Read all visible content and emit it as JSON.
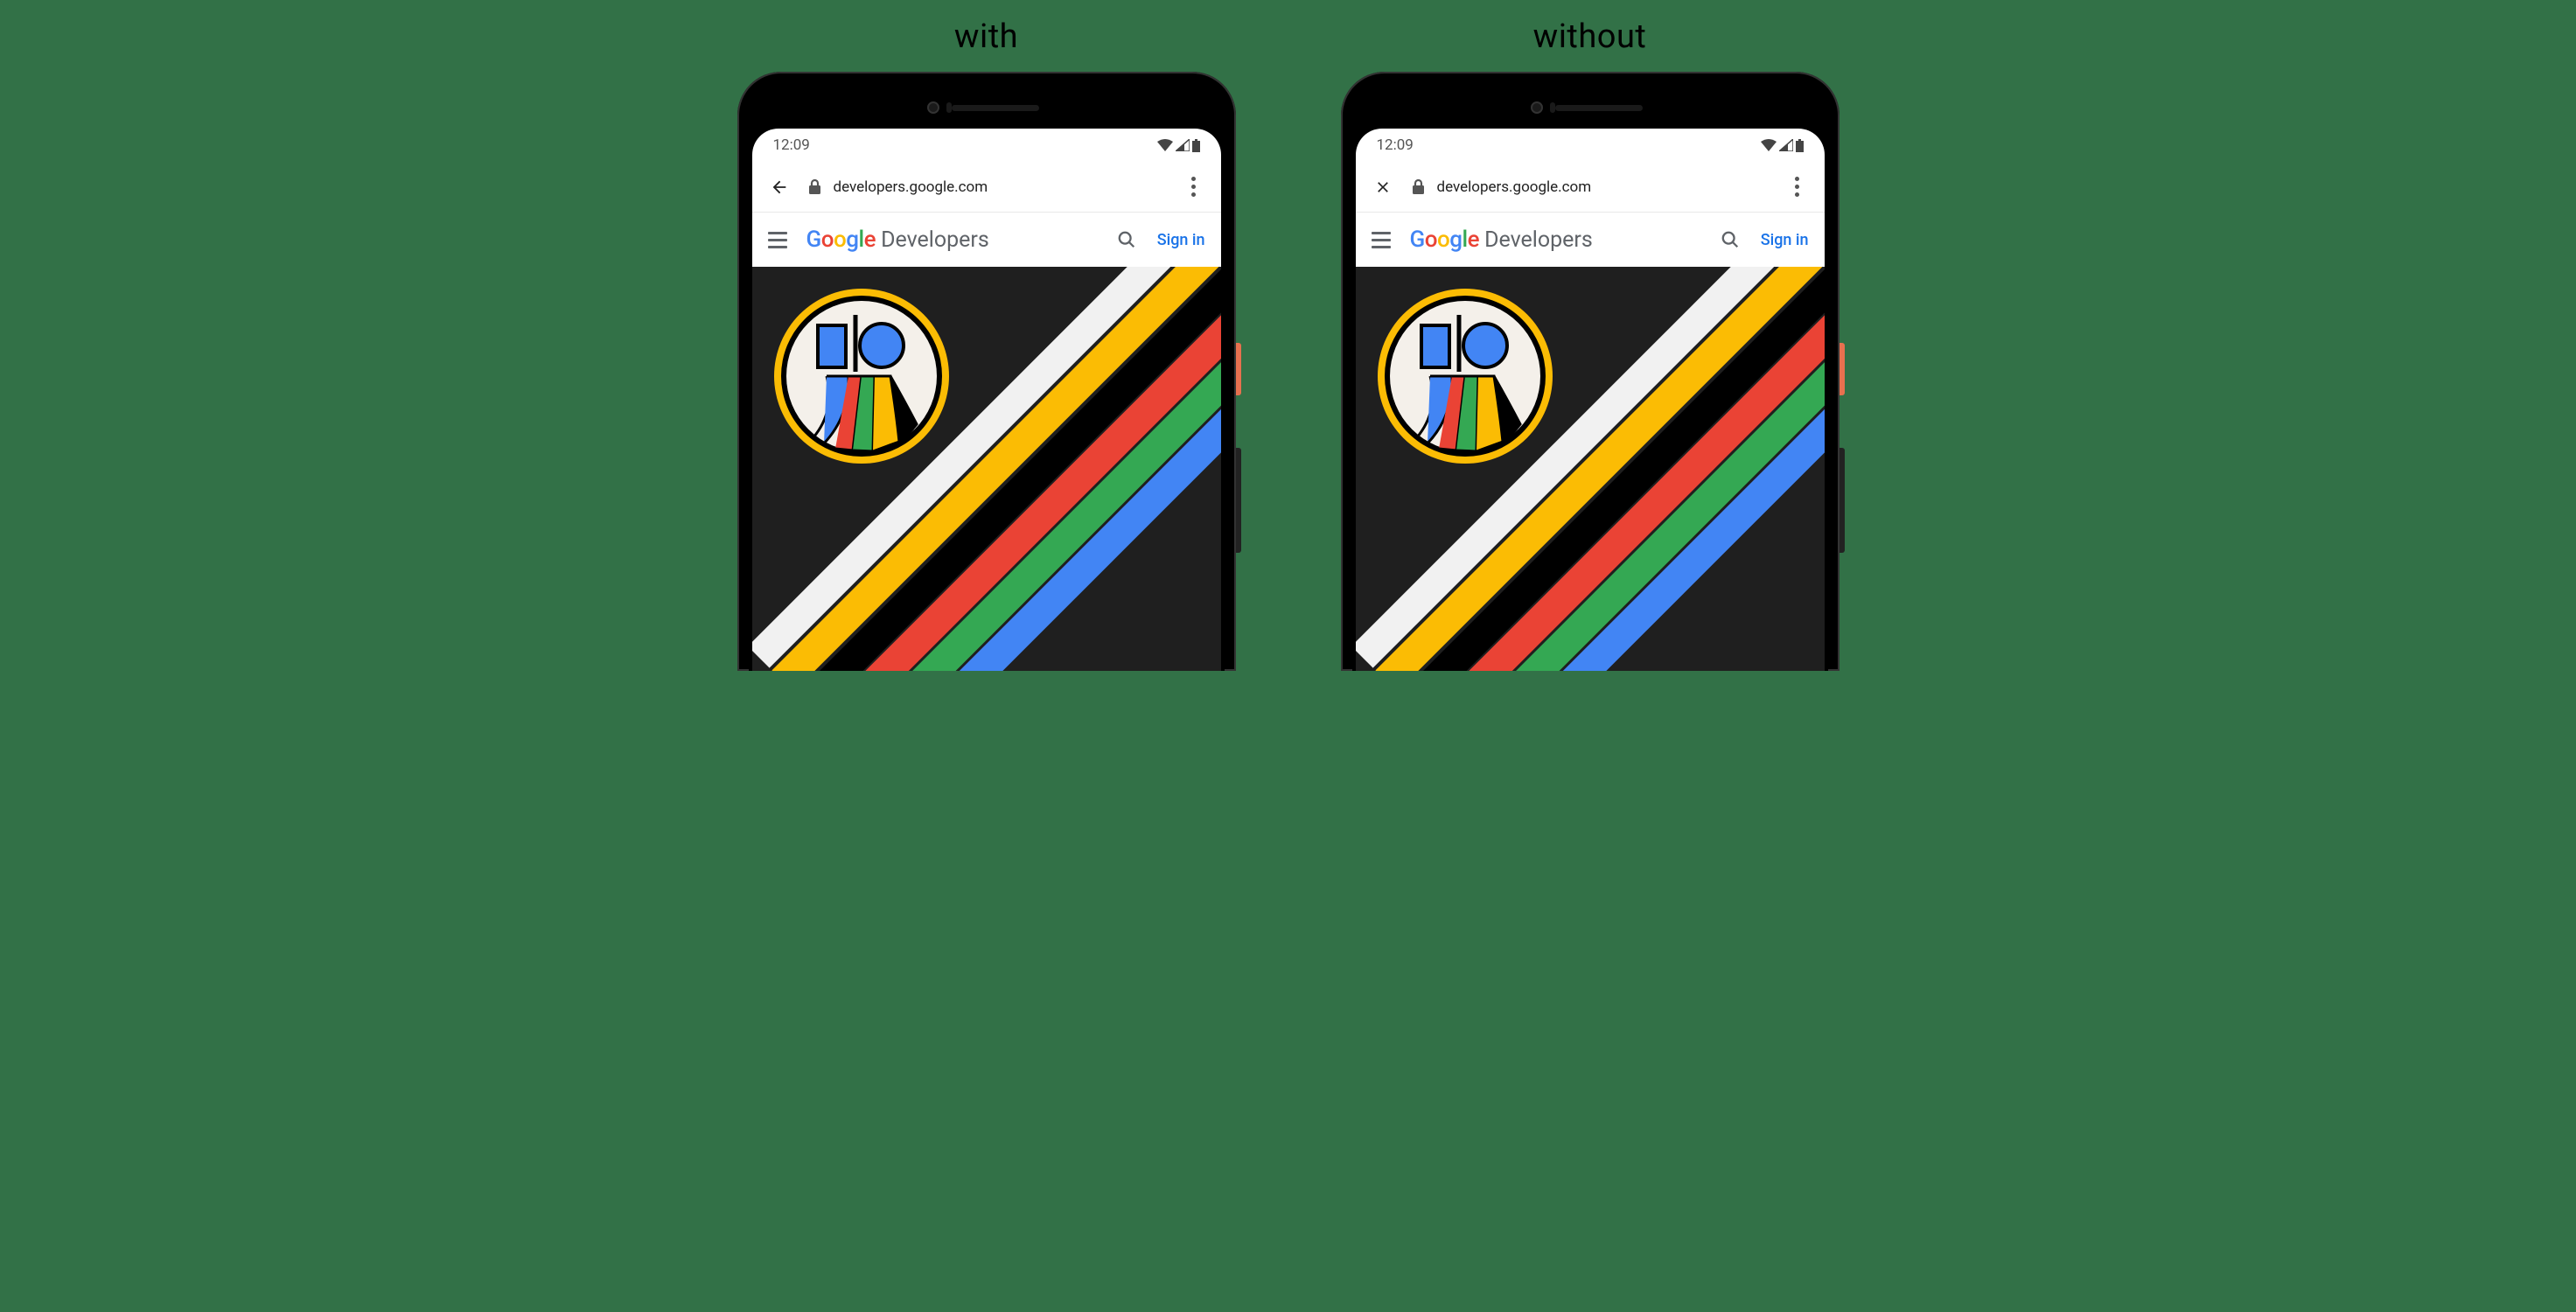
{
  "labels": {
    "with": "with",
    "without": "without"
  },
  "status_bar": {
    "time": "12:09"
  },
  "browser": {
    "url": "developers.google.com"
  },
  "site_header": {
    "logo_word": "Google",
    "brand_text": "Developers",
    "signin": "Sign in"
  },
  "google_colors": {
    "blue": "#4285F4",
    "red": "#EA4335",
    "yellow": "#FBBC04",
    "green": "#34A853"
  }
}
